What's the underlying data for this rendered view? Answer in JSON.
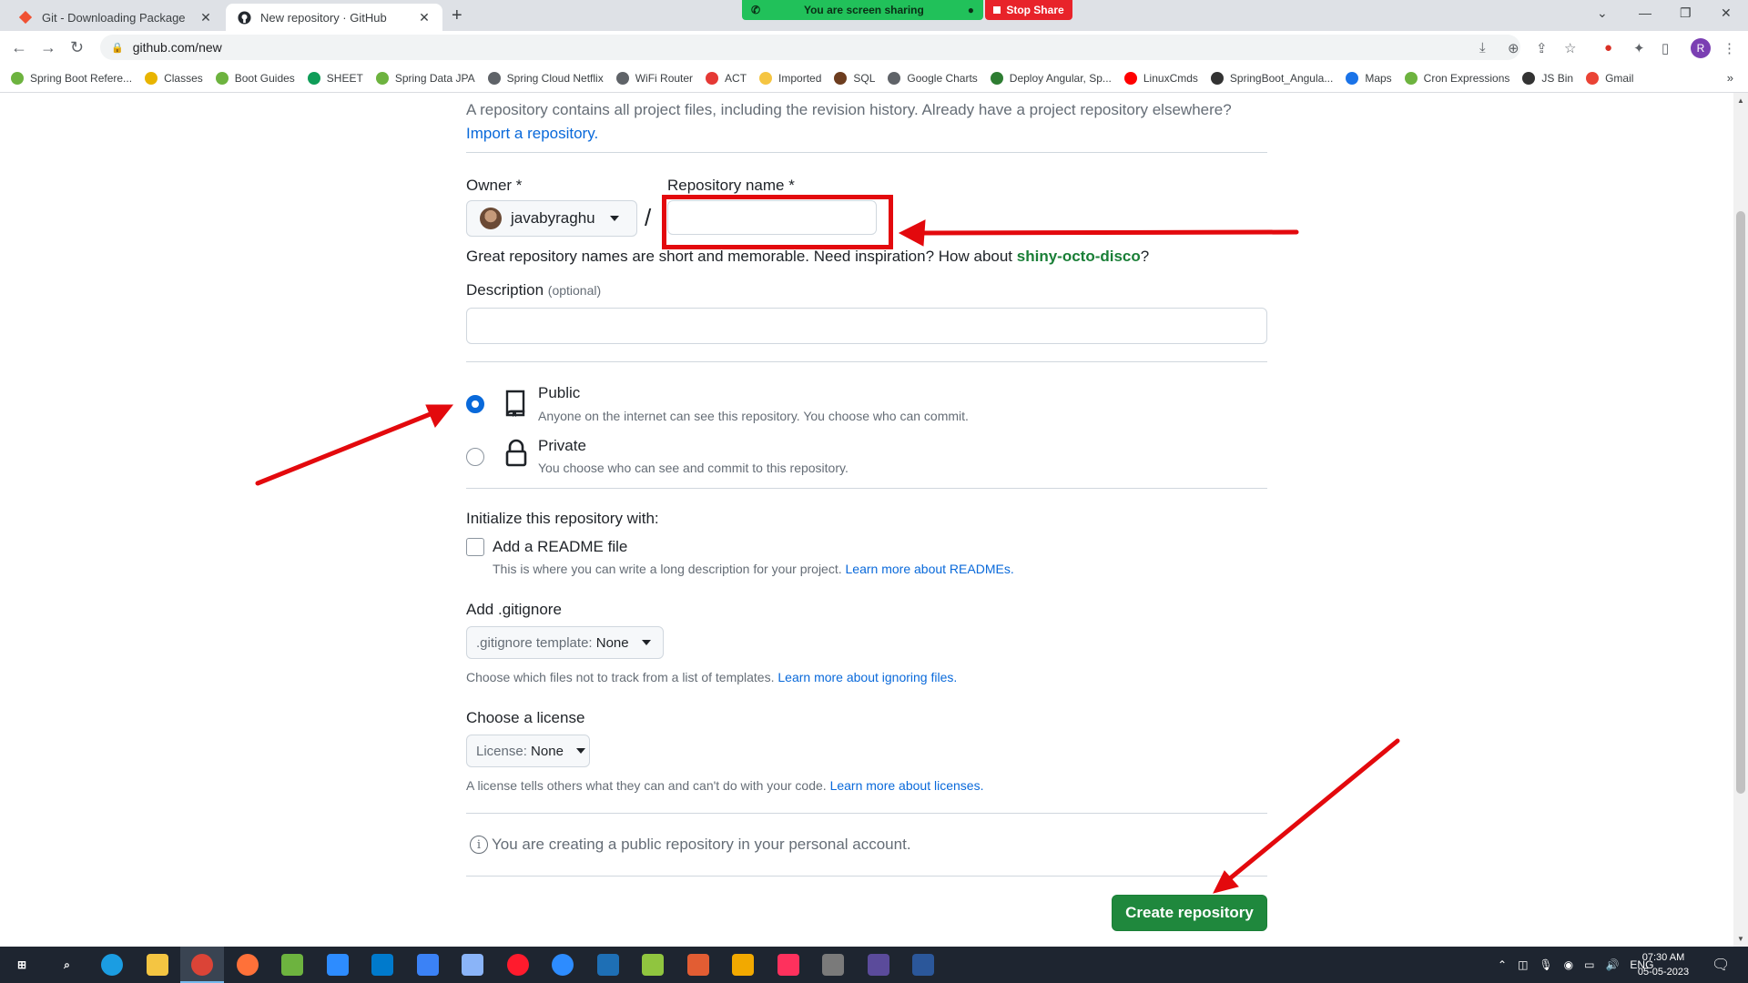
{
  "browser": {
    "tabs": [
      {
        "title": "Git - Downloading Package",
        "active": false
      },
      {
        "title": "New repository · GitHub",
        "active": true
      }
    ],
    "screen_share": {
      "status": "You are screen sharing",
      "stop_label": "Stop Share"
    },
    "url": "github.com/new",
    "bookmarks": [
      {
        "label": "Spring Boot Refere...",
        "icon": "spring-icon",
        "color": "#6db33f"
      },
      {
        "label": "Classes",
        "icon": "classes-icon",
        "color": "#e8b400"
      },
      {
        "label": "Boot Guides",
        "icon": "spring-icon",
        "color": "#6db33f"
      },
      {
        "label": "SHEET",
        "icon": "sheets-icon",
        "color": "#0f9d58"
      },
      {
        "label": "Spring Data JPA",
        "icon": "spring-icon",
        "color": "#6db33f"
      },
      {
        "label": "Spring Cloud Netflix",
        "icon": "globe-icon",
        "color": "#5f6368"
      },
      {
        "label": "WiFi Router",
        "icon": "globe-icon",
        "color": "#5f6368"
      },
      {
        "label": "ACT",
        "icon": "act-icon",
        "color": "#e53935"
      },
      {
        "label": "Imported",
        "icon": "folder-icon",
        "color": "#f5c542"
      },
      {
        "label": "SQL",
        "icon": "sql-icon",
        "color": "#6d3d1f"
      },
      {
        "label": "Google Charts",
        "icon": "code-icon",
        "color": "#5f6368"
      },
      {
        "label": "Deploy Angular, Sp...",
        "icon": "deploy-icon",
        "color": "#2e7d32"
      },
      {
        "label": "LinuxCmds",
        "icon": "youtube-icon",
        "color": "#ff0000"
      },
      {
        "label": "SpringBoot_Angula...",
        "icon": "angular-icon",
        "color": "#333333"
      },
      {
        "label": "Maps",
        "icon": "maps-icon",
        "color": "#1a73e8"
      },
      {
        "label": "Cron Expressions",
        "icon": "spring-icon",
        "color": "#6db33f"
      },
      {
        "label": "JS Bin",
        "icon": "jsbin-icon",
        "color": "#333333"
      },
      {
        "label": "Gmail",
        "icon": "gmail-icon",
        "color": "#ea4335"
      }
    ],
    "profile_initial": "R"
  },
  "page": {
    "intro_text": "A repository contains all project files, including the revision history. Already have a project repository elsewhere?",
    "import_link": "Import a repository.",
    "owner_label": "Owner *",
    "owner_value": "javabyraghu",
    "slash": "/",
    "repo_name_label": "Repository name *",
    "repo_name_value": "",
    "name_hint_prefix": "Great repository names are short and memorable. Need inspiration? How about ",
    "name_suggestion": "shiny-octo-disco",
    "name_hint_suffix": "?",
    "description_label": "Description",
    "description_optional": "(optional)",
    "description_value": "",
    "visibility": {
      "selected": "public",
      "public_title": "Public",
      "public_desc": "Anyone on the internet can see this repository. You choose who can commit.",
      "private_title": "Private",
      "private_desc": "You choose who can see and commit to this repository."
    },
    "init_heading": "Initialize this repository with:",
    "readme_label": "Add a README file",
    "readme_checked": false,
    "readme_desc": "This is where you can write a long description for your project.",
    "readme_link": "Learn more about READMEs.",
    "gitignore_heading": "Add .gitignore",
    "gitignore_select_label": ".gitignore template:",
    "gitignore_select_value": "None",
    "gitignore_desc": "Choose which files not to track from a list of templates.",
    "gitignore_link": "Learn more about ignoring files.",
    "license_heading": "Choose a license",
    "license_select_label": "License:",
    "license_select_value": "None",
    "license_desc": "A license tells others what they can and can't do with your code.",
    "license_link": "Learn more about licenses.",
    "info_text": "You are creating a public repository in your personal account.",
    "create_button": "Create repository"
  },
  "taskbar": {
    "time": "07:30 AM",
    "date": "05-05-2023",
    "language": "ENG",
    "apps": [
      "windows-start",
      "search",
      "edge",
      "file-explorer",
      "chrome",
      "firefox",
      "spring-tool-suite",
      "video-app",
      "vscode",
      "app-arrow",
      "remote-desktop",
      "opera",
      "zoom",
      "virtualbox",
      "notepad-plus",
      "paint",
      "grid-app",
      "intellij",
      "snipping-tool",
      "eclipse",
      "word"
    ]
  },
  "colors": {
    "annotation_red": "#e3090d",
    "github_green": "#1f883d",
    "link_blue": "#0969da",
    "suggestion_green": "#1a7f37"
  }
}
